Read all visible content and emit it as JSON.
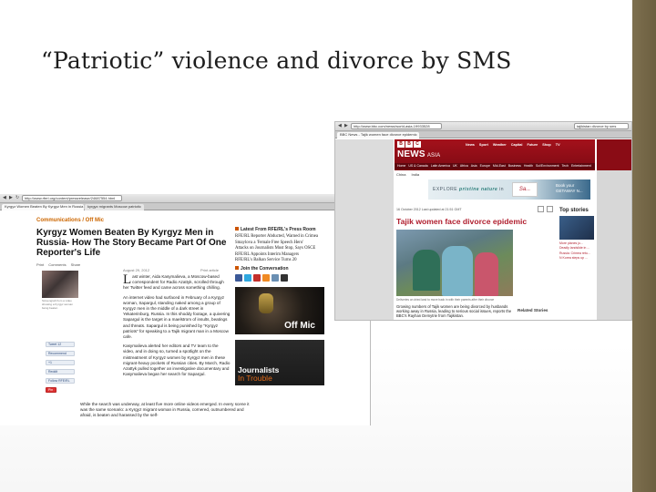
{
  "slide": {
    "title": "“Patriotic” violence and divorce by SMS",
    "accent_color": "#6f6244"
  },
  "screenshot_rferl": {
    "url": "http://www.rferl.org/content/pressrelease/24687554.html",
    "tabs": [
      "Kyrgyz Women Beaten By Kyrgyz Men in Russia",
      "kyrgyz migrants Moscow patriotic"
    ],
    "section": "Communications / Off Mic",
    "headline": "Kyrgyz Women Beaten By Kyrgyz Men in Russia- How The Story Became Part Of One Reporter's Life",
    "share": [
      "Print",
      "Comments",
      "Share"
    ],
    "date": "August 29, 2012",
    "print": "Print article",
    "photo_caption": "Screengrab from a video showing a Kyrgyz woman being beaten",
    "social": [
      "Tweet 12",
      "Recommend",
      "+1",
      "Reddit",
      "Follow RFE/RL",
      "Pin"
    ],
    "paragraphs": [
      "Last winter, Aida Kasymalieva, a Moscow-based correspondent for Radio Azattyk, scrolled through her Twitter feed and came across something chilling.",
      "An internet video had surfaced in February of a Kyrgyz woman, Sapargul, standing naked among a group of Kyrgyz men in the middle of a dark street in Yekaterinburg, Russia. In this shoddy footage, a quivering Sapargul is the target in a maelstrom of insults, beatings and threats. Sapargul is being punished by \"Kyrgyz patriots\" for speaking to a Tajik migrant man in a Moscow cafe.",
      "Kasymalieva alerted her editors and TV team to the video, and in doing so, turned a spotlight on the mistreatment of Kyrgyz women by Kyrgyz men in these migrant-heavy pockets of Russian cities. By March, Radio Azattyk pulled together an investigative documentary and Kasymalieva began her search for Sapargul."
    ],
    "bottom_paragraph": "While the search was underway, at least five more online videos emerged. In every scene it was the same scenario: a Kyrgyz migrant woman in Russia, cornered, outnumbered and afraid, is beaten and harassed by the self-",
    "rail": {
      "press_heading": "Latest From RFE/RL's Press Room",
      "press_items": [
        "RFE/RL Reporter Abducted, Warned in Crimea",
        "Smaylova a 'Female Free Speech Hero'",
        "Attacks on Journalists Must Stop, Says OSCE",
        "RFE/RL Appoints Interim Managers",
        "RFE/RL's Balkan Service Turns 20"
      ],
      "conversation_heading": "Join the Conversation",
      "icons": [
        "facebook-icon",
        "twitter-icon",
        "youtube-icon",
        "rss-icon",
        "email-icon",
        "mobile-icon"
      ],
      "promo_offmic": "Off Mic",
      "promo_journalists_1": "Journalists",
      "promo_journalists_2": "In Trouble"
    }
  },
  "screenshot_bbc": {
    "url": "http://www.bbc.com/news/world-asia-19933528",
    "tab": "BBC News - Tajik women face divorce epidemic",
    "search": "tajikistan divorce by sms",
    "logo": [
      "B",
      "B",
      "C"
    ],
    "brand": "NEWS",
    "brand_region": "ASIA",
    "top_nav": [
      "News",
      "Sport",
      "Weather",
      "Capital",
      "Future",
      "Shop",
      "TV"
    ],
    "sub_nav": [
      "Home",
      "US & Canada",
      "Latin America",
      "UK",
      "Africa",
      "Asia",
      "Europe",
      "Mid-East",
      "Business",
      "Health",
      "Sci/Environment",
      "Tech",
      "Entertainment"
    ],
    "region_tabs": [
      "China",
      "India"
    ],
    "ad_text_1": "EXPLORE",
    "ad_text_2": "pristine nature",
    "ad_text_3": "in",
    "ad_logo": "Sa...",
    "ad_right": "Book your GETAWAY N...",
    "date": "16 October 2012  Last updated at 21:51 GMT",
    "headline": "Tajik women face divorce epidemic",
    "photo_caption": "Deliveries on dried land to move back in with their parents after their divorce",
    "body": "Growing numbers of Tajik women are being divorced by husbands working away in Russia, leading to serious social issues, reports the BBC's Rayhan Demytrie from Tajikistan.",
    "related": "Related Stories",
    "top_stories_heading": "Top stories",
    "top_stories": [
      "More planes jo...",
      "Deadly landslide in ...",
      "Russia: Crimea retu...",
      "N Korea steps up ..."
    ]
  }
}
